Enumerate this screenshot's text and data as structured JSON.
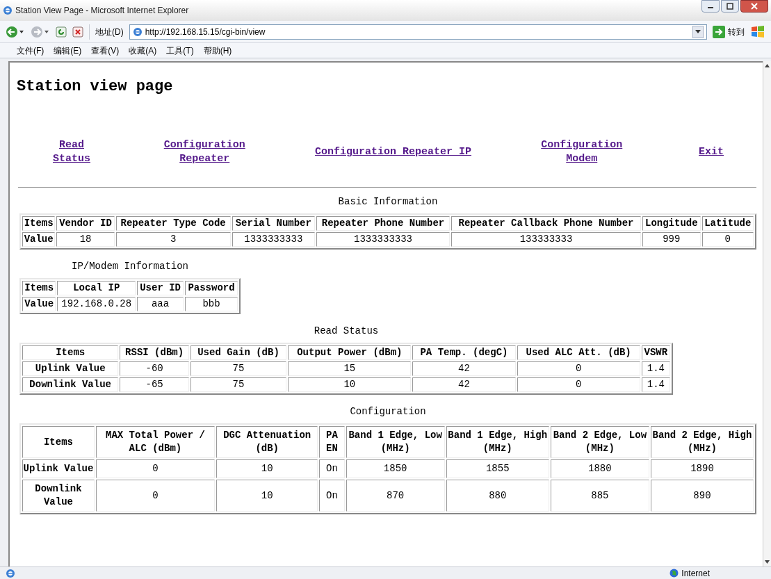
{
  "window": {
    "title": "Station View Page - Microsoft Internet Explorer"
  },
  "toolbar": {
    "address_label": "地址(D)",
    "url": "http://192.168.15.15/cgi-bin/view",
    "go_label": "转到"
  },
  "menu": [
    "文件(F)",
    "编辑(E)",
    "查看(V)",
    "收藏(A)",
    "工具(T)",
    "帮助(H)"
  ],
  "page": {
    "heading": "Station view page",
    "nav_links": [
      {
        "label": "Read Status"
      },
      {
        "label": "Configuration Repeater"
      },
      {
        "label": "Configuration Repeater IP"
      },
      {
        "label": "Configuration Modem"
      },
      {
        "label": "Exit"
      }
    ],
    "tables": [
      {
        "title": "Basic Information",
        "columns": [
          "Items",
          "Vendor ID",
          "Repeater Type Code",
          "Serial Number",
          "Repeater Phone Number",
          "Repeater Callback Phone Number",
          "Longitude",
          "Latitude"
        ],
        "rows": [
          [
            "Value",
            "18",
            "3",
            "1333333333",
            "1333333333",
            "133333333",
            "999",
            "0"
          ]
        ]
      },
      {
        "title": "IP/Modem Information",
        "columns": [
          "Items",
          "Local IP",
          "User ID",
          "Password"
        ],
        "rows": [
          [
            "Value",
            "192.168.0.28",
            "aaa",
            "bbb"
          ]
        ]
      },
      {
        "title": "Read Status",
        "columns": [
          "Items",
          "RSSI (dBm)",
          "Used Gain (dB)",
          "Output Power (dBm)",
          "PA Temp. (degC)",
          "Used ALC Att. (dB)",
          "VSWR"
        ],
        "rows": [
          [
            "Uplink Value",
            "-60",
            "75",
            "15",
            "42",
            "0",
            "1.4"
          ],
          [
            "Downlink Value",
            "-65",
            "75",
            "10",
            "42",
            "0",
            "1.4"
          ]
        ]
      },
      {
        "title": "Configuration",
        "columns": [
          "Items",
          "MAX Total Power / ALC (dBm)",
          "DGC Attenuation (dB)",
          "PA EN",
          "Band 1 Edge, Low (MHz)",
          "Band 1 Edge, High (MHz)",
          "Band 2 Edge, Low (MHz)",
          "Band 2 Edge, High (MHz)"
        ],
        "rows": [
          [
            "Uplink Value",
            "0",
            "10",
            "On",
            "1850",
            "1855",
            "1880",
            "1890"
          ],
          [
            "Downlink Value",
            "0",
            "10",
            "On",
            "870",
            "880",
            "885",
            "890"
          ]
        ]
      }
    ]
  },
  "status_bar": {
    "zone": "Internet"
  }
}
